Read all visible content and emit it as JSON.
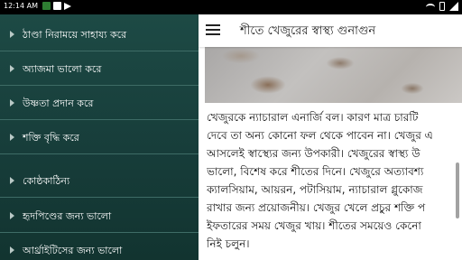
{
  "status_bar": {
    "time": "12:14 AM",
    "left_icons": [
      "whatsapp-icon",
      "shopping-bag-icon",
      "send-icon"
    ],
    "right_icons": [
      "wifi-icon",
      "battery-icon",
      "cellular-signal-icon"
    ]
  },
  "drawer": {
    "items": [
      {
        "label": "ঠাণ্ডা নিরাময়ে সাহায্য করে"
      },
      {
        "label": "অ্যাজমা ভালো করে"
      },
      {
        "label": "উষ্ণতা প্রদান করে"
      },
      {
        "label": "শক্তি বৃদ্ধি করে"
      },
      {
        "label": "কোষ্ঠকাঠিন্য"
      },
      {
        "label": "হৃদপিণ্ডের জন্য ভালো"
      },
      {
        "label": "আর্থ্রাইটিসের জন্য ভালো"
      }
    ]
  },
  "toolbar": {
    "menu_icon": "hamburger-menu-icon",
    "title": "শীতে খেজুরের স্বাস্থ্য গুনাগুন"
  },
  "article": {
    "lines": [
      "খেজুরকে ন্যাচারাল এনার্জি বল। কারণ মাত্র চারটি",
      "দেবে তা অন্য কোনো ফল থেকে পাবেন না। খেজুর এ",
      "আসলেই স্বাস্থ্যের জন্য উপকারী। খেজুরের স্বাস্থ্য উ",
      "ভালো, বিশেষ করে শীতের দিনে। খেজুরে অত্যাবশ্য",
      "ক্যালসিয়াম, আয়রন, পটাসিয়াম, ন্যাচারাল গ্লুকোজ",
      "রাখার জন্য প্রয়োজনীয়। খেজুর খেলে প্রচুর শক্তি প",
      "ইফতারের সময় খেজুর খায়। শীতের সময়েও কেনো",
      "নিই চলুন।"
    ]
  },
  "colors": {
    "drawer_bg": "#1d4a45",
    "drawer_divider": "#3e6c66",
    "toolbar_bg": "#ffffff",
    "status_bar_bg": "#000000"
  }
}
